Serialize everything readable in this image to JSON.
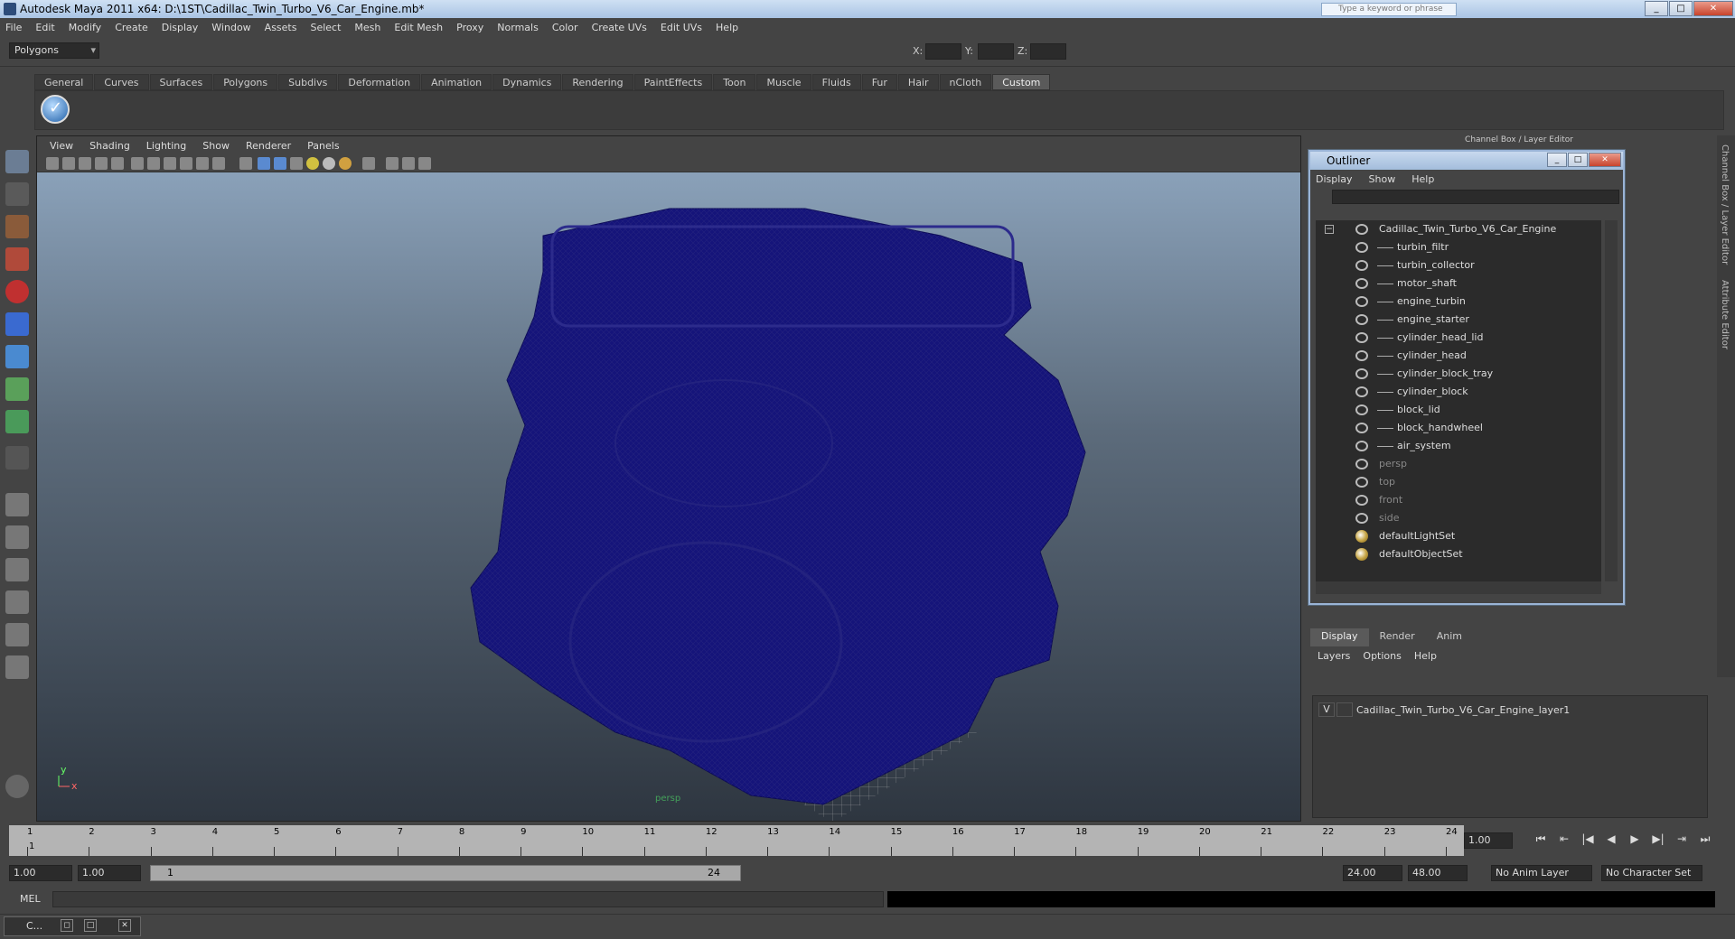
{
  "window": {
    "title": "Autodesk Maya 2011 x64: D:\\1ST\\Cadillac_Twin_Turbo_V6_Car_Engine.mb*",
    "search_placeholder": "Type a keyword or phrase"
  },
  "menubar": [
    "File",
    "Edit",
    "Modify",
    "Create",
    "Display",
    "Window",
    "Assets",
    "Select",
    "Mesh",
    "Edit Mesh",
    "Proxy",
    "Normals",
    "Color",
    "Create UVs",
    "Edit UVs",
    "Help"
  ],
  "toolbar": {
    "mode": "Polygons",
    "x_label": "X:",
    "y_label": "Y:",
    "z_label": "Z:"
  },
  "shelf_tabs": [
    "General",
    "Curves",
    "Surfaces",
    "Polygons",
    "Subdivs",
    "Deformation",
    "Animation",
    "Dynamics",
    "Rendering",
    "PaintEffects",
    "Toon",
    "Muscle",
    "Fluids",
    "Fur",
    "Hair",
    "nCloth",
    "Custom"
  ],
  "shelf_active_tab": "Custom",
  "viewport": {
    "menu": [
      "View",
      "Shading",
      "Lighting",
      "Show",
      "Renderer",
      "Panels"
    ],
    "camera_label": "persp",
    "axis_x": "x",
    "axis_y": "y",
    "wire_color": "#14137a"
  },
  "panel_title": "Channel Box / Layer Editor",
  "right_strip": {
    "channel_box": "Channel Box / Layer Editor",
    "attribute_editor": "Attribute Editor"
  },
  "outliner": {
    "title": "Outliner",
    "menu": [
      "Display",
      "Show",
      "Help"
    ],
    "root": "Cadillac_Twin_Turbo_V6_Car_Engine",
    "children": [
      "turbin_filtr",
      "turbin_collector",
      "motor_shaft",
      "engine_turbin",
      "engine_starter",
      "cylinder_head_lid",
      "cylinder_head",
      "cylinder_block_tray",
      "cylinder_block",
      "block_lid",
      "block_handwheel",
      "air_system"
    ],
    "cameras": [
      "persp",
      "top",
      "front",
      "side"
    ],
    "sets": [
      "defaultLightSet",
      "defaultObjectSet"
    ]
  },
  "layer_editor": {
    "tabs": [
      "Display",
      "Render",
      "Anim"
    ],
    "active_tab": "Display",
    "menu": [
      "Layers",
      "Options",
      "Help"
    ],
    "layer": {
      "visible": "V",
      "name": "Cadillac_Twin_Turbo_V6_Car_Engine_layer1"
    }
  },
  "timeline": {
    "ticks": [
      "1",
      "2",
      "3",
      "4",
      "5",
      "6",
      "7",
      "8",
      "9",
      "10",
      "11",
      "12",
      "13",
      "14",
      "15",
      "16",
      "17",
      "18",
      "19",
      "20",
      "21",
      "22",
      "23",
      "24"
    ],
    "current_frame": "1",
    "current_frame_field": "1.00"
  },
  "range": {
    "start_time": "1.00",
    "playback_start": "1.00",
    "range_start": "1",
    "range_end": "24",
    "playback_end": "24.00",
    "end_time": "48.00",
    "anim_layer": "No Anim Layer",
    "character_set": "No Character Set"
  },
  "command_line": {
    "label": "MEL"
  },
  "taskbar": {
    "item": "C..."
  }
}
